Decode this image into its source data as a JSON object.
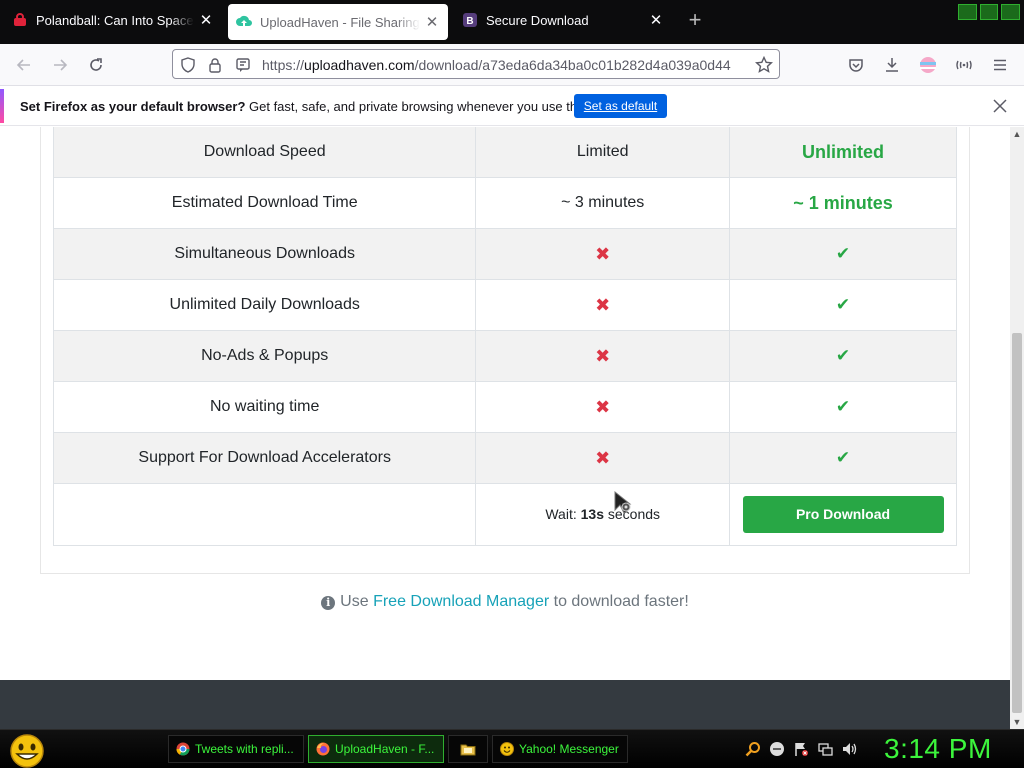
{
  "tabs": [
    {
      "title": "Polandball: Can Into Space! Fre",
      "active": false,
      "icon": "polandball-icon"
    },
    {
      "title": "UploadHaven - File Sharing Ma",
      "active": true,
      "icon": "uploadhaven-icon"
    },
    {
      "title": "Secure Download",
      "active": false,
      "icon": "bootstrap-icon"
    }
  ],
  "tab_close_glyph": "✕",
  "new_tab_glyph": "+",
  "navbar": {
    "url_scheme": "https://",
    "url_host": "uploadhaven.com",
    "url_path": "/download/a73eda6da34ba0c01b282d4a039a0d44"
  },
  "notification": {
    "bold": "Set Firefox as your default browser?",
    "text": " Get fast, safe, and private browsing whenever you use the web.",
    "button": "Set as default"
  },
  "table": {
    "rows": [
      {
        "feature": "Download Speed",
        "free": "Limited",
        "pro": "Unlimited",
        "kind": "text"
      },
      {
        "feature": "Estimated Download Time",
        "free": "~ 3 minutes",
        "pro": "~ 1 minutes",
        "kind": "text"
      },
      {
        "feature": "Simultaneous Downloads",
        "free": "✖",
        "pro": "✔",
        "kind": "mark"
      },
      {
        "feature": "Unlimited Daily Downloads",
        "free": "✖",
        "pro": "✔",
        "kind": "mark"
      },
      {
        "feature": "No-Ads & Popups",
        "free": "✖",
        "pro": "✔",
        "kind": "mark"
      },
      {
        "feature": "No waiting time",
        "free": "✖",
        "pro": "✔",
        "kind": "mark"
      },
      {
        "feature": "Support For Download Accelerators",
        "free": "✖",
        "pro": "✔",
        "kind": "mark"
      }
    ],
    "wait_prefix": "Wait: ",
    "wait_seconds": "13s",
    "wait_suffix": " seconds",
    "pro_button": "Pro Download"
  },
  "fdm": {
    "info_glyph": "i",
    "prefix": "Use ",
    "link": "Free Download Manager",
    "suffix": " to download faster!"
  },
  "taskbar": {
    "tasks": [
      {
        "label": "Tweets with repli...",
        "icon": "chrome-icon",
        "active": false
      },
      {
        "label": "UploadHaven - F...",
        "icon": "firefox-icon",
        "active": true
      },
      {
        "label": "",
        "icon": "folder-icon",
        "active": false
      },
      {
        "label": "Yahoo! Messenger",
        "icon": "yahoo-messenger-icon",
        "active": false
      }
    ],
    "clock": "3:14 PM"
  },
  "colors": {
    "accent_green": "#28a745",
    "danger_red": "#dc3545",
    "link_teal": "#17a2b8",
    "firefox_blue": "#0061e0",
    "taskbar_green": "#3cf53c"
  }
}
